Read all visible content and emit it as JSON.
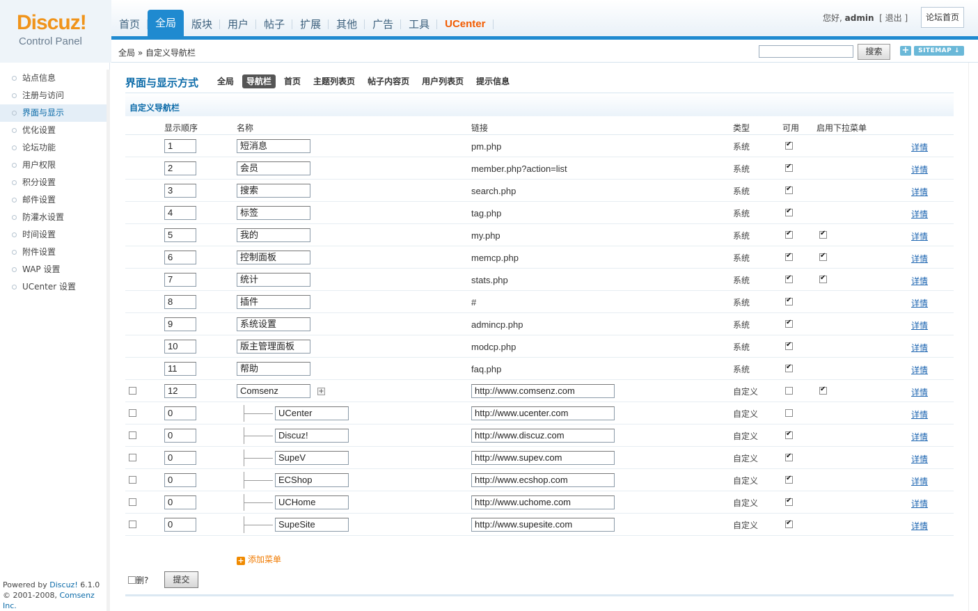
{
  "logo": {
    "brand": "Discuz!",
    "sub": "Control Panel"
  },
  "topnav": [
    {
      "label": "首页",
      "active": false
    },
    {
      "label": "全局",
      "active": true
    },
    {
      "label": "版块",
      "active": false
    },
    {
      "label": "用户",
      "active": false
    },
    {
      "label": "帖子",
      "active": false
    },
    {
      "label": "扩展",
      "active": false
    },
    {
      "label": "其他",
      "active": false
    },
    {
      "label": "广告",
      "active": false
    },
    {
      "label": "工具",
      "active": false
    },
    {
      "label": "UCenter",
      "active": false
    }
  ],
  "user": {
    "greeting": "您好,",
    "name": "admin",
    "logout": "退出",
    "forum_home": "论坛首页"
  },
  "breadcrumb": "全局 » 自定义导航栏",
  "search": {
    "value": "",
    "button": "搜索",
    "plus": "+",
    "sitemap": "SITEMAP ↓"
  },
  "sidebar": {
    "items": [
      {
        "label": "站点信息",
        "active": false
      },
      {
        "label": "注册与访问",
        "active": false
      },
      {
        "label": "界面与显示",
        "active": true
      },
      {
        "label": "优化设置",
        "active": false
      },
      {
        "label": "论坛功能",
        "active": false
      },
      {
        "label": "用户权限",
        "active": false
      },
      {
        "label": "积分设置",
        "active": false
      },
      {
        "label": "邮件设置",
        "active": false
      },
      {
        "label": "防灌水设置",
        "active": false
      },
      {
        "label": "时间设置",
        "active": false
      },
      {
        "label": "附件设置",
        "active": false
      },
      {
        "label": "WAP 设置",
        "active": false
      },
      {
        "label": "UCenter 设置",
        "active": false
      }
    ],
    "footer_powered": "Powered by",
    "footer_product": "Discuz!",
    "footer_version": "6.1.0",
    "footer_copy": "© 2001-2008,",
    "footer_company": "Comsenz Inc."
  },
  "main": {
    "section_title": "界面与显示方式",
    "subtabs": [
      {
        "label": "全局",
        "active": false
      },
      {
        "label": "导航栏",
        "active": true
      },
      {
        "label": "首页",
        "active": false
      },
      {
        "label": "主题列表页",
        "active": false
      },
      {
        "label": "帖子内容页",
        "active": false
      },
      {
        "label": "用户列表页",
        "active": false
      },
      {
        "label": "提示信息",
        "active": false
      }
    ],
    "bar_title": "自定义导航栏",
    "columns": {
      "order": "显示顺序",
      "name": "名称",
      "link": "链接",
      "type": "类型",
      "enabled": "可用",
      "dropdown": "启用下拉菜单"
    },
    "rows": [
      {
        "order": "1",
        "name": "短消息",
        "link": "pm.php",
        "type": "系统",
        "enabled": true,
        "dropdown": false,
        "custom": false,
        "child": false
      },
      {
        "order": "2",
        "name": "会员",
        "link": "member.php?action=list",
        "type": "系统",
        "enabled": true,
        "dropdown": false,
        "custom": false,
        "child": false
      },
      {
        "order": "3",
        "name": "搜索",
        "link": "search.php",
        "type": "系统",
        "enabled": true,
        "dropdown": false,
        "custom": false,
        "child": false
      },
      {
        "order": "4",
        "name": "标签",
        "link": "tag.php",
        "type": "系统",
        "enabled": true,
        "dropdown": false,
        "custom": false,
        "child": false
      },
      {
        "order": "5",
        "name": "我的",
        "link": "my.php",
        "type": "系统",
        "enabled": true,
        "dropdown": true,
        "custom": false,
        "child": false
      },
      {
        "order": "6",
        "name": "控制面板",
        "link": "memcp.php",
        "type": "系统",
        "enabled": true,
        "dropdown": true,
        "custom": false,
        "child": false
      },
      {
        "order": "7",
        "name": "统计",
        "link": "stats.php",
        "type": "系统",
        "enabled": true,
        "dropdown": true,
        "custom": false,
        "child": false
      },
      {
        "order": "8",
        "name": "插件",
        "link": "#",
        "type": "系统",
        "enabled": true,
        "dropdown": false,
        "custom": false,
        "child": false
      },
      {
        "order": "9",
        "name": "系统设置",
        "link": "admincp.php",
        "type": "系统",
        "enabled": true,
        "dropdown": false,
        "custom": false,
        "child": false
      },
      {
        "order": "10",
        "name": "版主管理面板",
        "link": "modcp.php",
        "type": "系统",
        "enabled": true,
        "dropdown": false,
        "custom": false,
        "child": false
      },
      {
        "order": "11",
        "name": "帮助",
        "link": "faq.php",
        "type": "系统",
        "enabled": true,
        "dropdown": false,
        "custom": false,
        "child": false
      },
      {
        "order": "12",
        "name": "Comsenz",
        "link": "http://www.comsenz.com",
        "type": "自定义",
        "enabled": false,
        "dropdown": true,
        "custom": true,
        "child": false
      },
      {
        "order": "0",
        "name": "UCenter",
        "link": "http://www.ucenter.com",
        "type": "自定义",
        "enabled": false,
        "dropdown": false,
        "custom": true,
        "child": true
      },
      {
        "order": "0",
        "name": "Discuz!",
        "link": "http://www.discuz.com",
        "type": "自定义",
        "enabled": true,
        "dropdown": false,
        "custom": true,
        "child": true
      },
      {
        "order": "0",
        "name": "SupeV",
        "link": "http://www.supev.com",
        "type": "自定义",
        "enabled": true,
        "dropdown": false,
        "custom": true,
        "child": true
      },
      {
        "order": "0",
        "name": "ECShop",
        "link": "http://www.ecshop.com",
        "type": "自定义",
        "enabled": true,
        "dropdown": false,
        "custom": true,
        "child": true
      },
      {
        "order": "0",
        "name": "UCHome",
        "link": "http://www.uchome.com",
        "type": "自定义",
        "enabled": true,
        "dropdown": false,
        "custom": true,
        "child": true
      },
      {
        "order": "0",
        "name": "SupeSite",
        "link": "http://www.supesite.com",
        "type": "自定义",
        "enabled": true,
        "dropdown": false,
        "custom": true,
        "child": true
      }
    ],
    "detail_label": "详情",
    "add_menu": "添加菜单",
    "delete_label": "删?",
    "submit": "提交"
  },
  "colors": {
    "accent": "#1f8ad0",
    "brand": "#f0941b",
    "ucenter": "#f25b00",
    "link": "#1a63b0"
  }
}
